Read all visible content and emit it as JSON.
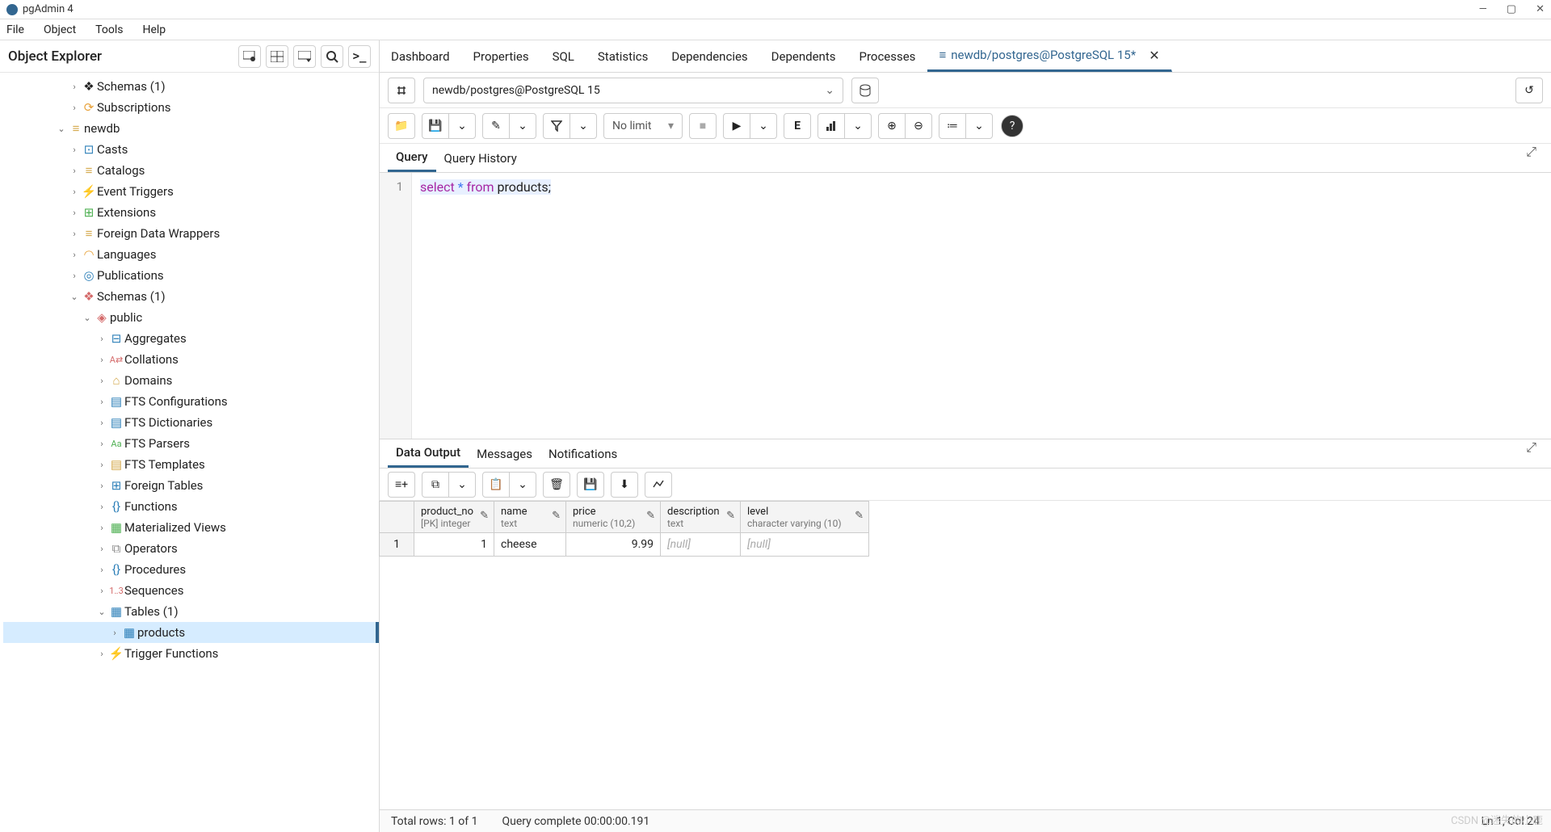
{
  "window": {
    "title": "pgAdmin 4"
  },
  "menubar": [
    "File",
    "Object",
    "Tools",
    "Help"
  ],
  "sidebar": {
    "title": "Object Explorer",
    "nodes": {
      "schemas_root": "Schemas (1)",
      "subscriptions": "Subscriptions",
      "db": "newdb",
      "casts": "Casts",
      "catalogs": "Catalogs",
      "event_triggers": "Event Triggers",
      "extensions": "Extensions",
      "fdw": "Foreign Data Wrappers",
      "languages": "Languages",
      "publications": "Publications",
      "schemas2": "Schemas (1)",
      "public": "public",
      "aggregates": "Aggregates",
      "collations": "Collations",
      "domains": "Domains",
      "fts_conf": "FTS Configurations",
      "fts_dict": "FTS Dictionaries",
      "fts_pars": "FTS Parsers",
      "fts_tmpl": "FTS Templates",
      "ftables": "Foreign Tables",
      "functions": "Functions",
      "mviews": "Materialized Views",
      "operators": "Operators",
      "procedures": "Procedures",
      "sequences": "Sequences",
      "tables": "Tables (1)",
      "products": "products",
      "trigfn": "Trigger Functions"
    }
  },
  "tabs": {
    "items": [
      "Dashboard",
      "Properties",
      "SQL",
      "Statistics",
      "Dependencies",
      "Dependents",
      "Processes"
    ],
    "active": "newdb/postgres@PostgreSQL 15*"
  },
  "conn": {
    "label": "newdb/postgres@PostgreSQL 15"
  },
  "toolbar": {
    "nolimit": "No limit"
  },
  "qtabs": {
    "query": "Query",
    "history": "Query History"
  },
  "editor": {
    "line1_no": "1",
    "kw_select": "select",
    "star": "*",
    "kw_from": "from",
    "table": "products",
    "semi": ";"
  },
  "otabs": {
    "data": "Data Output",
    "msg": "Messages",
    "notif": "Notifications"
  },
  "grid": {
    "cols": [
      {
        "name": "product_no",
        "type": "[PK] integer"
      },
      {
        "name": "name",
        "type": "text"
      },
      {
        "name": "price",
        "type": "numeric (10,2)"
      },
      {
        "name": "description",
        "type": "text"
      },
      {
        "name": "level",
        "type": "character varying (10)"
      }
    ],
    "rows": [
      {
        "idx": "1",
        "product_no": "1",
        "name": "cheese",
        "price": "9.99",
        "description": "[null]",
        "level": "[null]"
      }
    ]
  },
  "status": {
    "rows": "Total rows: 1 of 1",
    "msg": "Query complete 00:00:00.191",
    "pos": "Ln 1, Col 24"
  },
  "watermark": "CSDN @迷失的小鹿"
}
